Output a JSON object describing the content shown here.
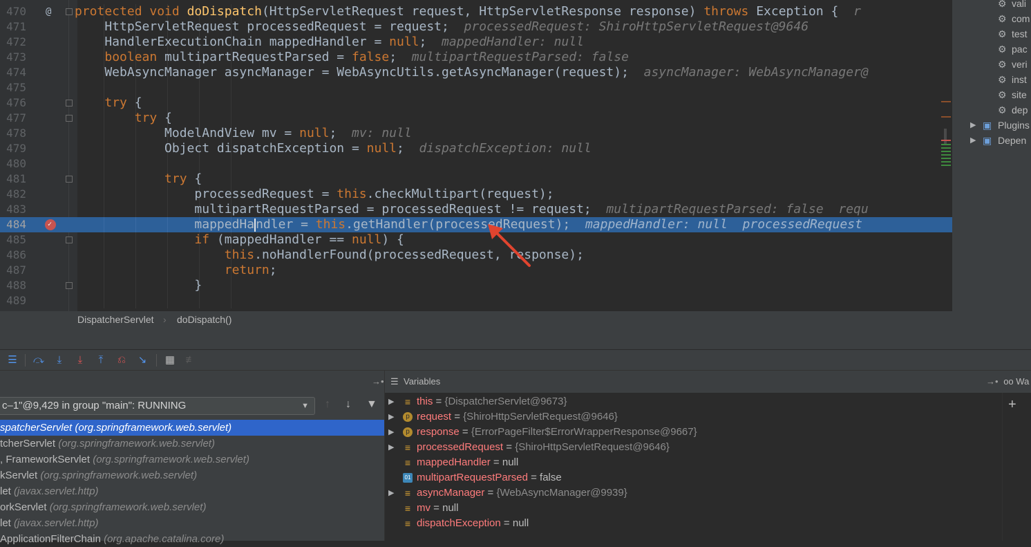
{
  "editor": {
    "lines": [
      {
        "num": "470",
        "tokens": [
          {
            "t": "protected void ",
            "c": "kw"
          },
          {
            "t": "doDispatch",
            "c": "me"
          },
          {
            "t": "(HttpServletRequest request, HttpServletResponse response) "
          },
          {
            "t": "throws ",
            "c": "kw"
          },
          {
            "t": "Exception {  "
          },
          {
            "t": "r",
            "c": "hint"
          }
        ]
      },
      {
        "num": "471",
        "tokens": [
          {
            "t": "    HttpServletRequest processedRequest = request;"
          },
          {
            "t": "  processedRequest: ShiroHttpServletRequest@9646",
            "c": "hint"
          }
        ]
      },
      {
        "num": "472",
        "tokens": [
          {
            "t": "    HandlerExecutionChain mappedHandler = "
          },
          {
            "t": "null",
            "c": "kw"
          },
          {
            "t": ";"
          },
          {
            "t": "  mappedHandler: null",
            "c": "hint"
          }
        ]
      },
      {
        "num": "473",
        "tokens": [
          {
            "t": "    "
          },
          {
            "t": "boolean ",
            "c": "kw"
          },
          {
            "t": "multipartRequestParsed = "
          },
          {
            "t": "false",
            "c": "kw"
          },
          {
            "t": ";"
          },
          {
            "t": "  multipartRequestParsed: false",
            "c": "hint"
          }
        ]
      },
      {
        "num": "474",
        "tokens": [
          {
            "t": "    WebAsyncManager asyncManager = WebAsyncUtils.getAsyncManager(request);"
          },
          {
            "t": "  asyncManager: WebAsyncManager@",
            "c": "hint"
          }
        ]
      },
      {
        "num": "475",
        "tokens": []
      },
      {
        "num": "476",
        "tokens": [
          {
            "t": "    "
          },
          {
            "t": "try ",
            "c": "kw"
          },
          {
            "t": "{"
          }
        ]
      },
      {
        "num": "477",
        "tokens": [
          {
            "t": "        "
          },
          {
            "t": "try ",
            "c": "kw"
          },
          {
            "t": "{"
          }
        ]
      },
      {
        "num": "478",
        "tokens": [
          {
            "t": "            ModelAndView mv = "
          },
          {
            "t": "null",
            "c": "kw"
          },
          {
            "t": ";"
          },
          {
            "t": "  mv: null",
            "c": "hint"
          }
        ]
      },
      {
        "num": "479",
        "tokens": [
          {
            "t": "            Object dispatchException = "
          },
          {
            "t": "null",
            "c": "kw"
          },
          {
            "t": ";"
          },
          {
            "t": "  dispatchException: null",
            "c": "hint"
          }
        ]
      },
      {
        "num": "480",
        "tokens": []
      },
      {
        "num": "481",
        "tokens": [
          {
            "t": "            "
          },
          {
            "t": "try ",
            "c": "kw"
          },
          {
            "t": "{"
          }
        ]
      },
      {
        "num": "482",
        "tokens": [
          {
            "t": "                processedRequest = "
          },
          {
            "t": "this",
            "c": "kw"
          },
          {
            "t": ".checkMultipart(request);"
          }
        ]
      },
      {
        "num": "483",
        "tokens": [
          {
            "t": "                multipartRequestParsed = processedRequest != request;"
          },
          {
            "t": "  multipartRequestParsed: false  requ",
            "c": "hint"
          }
        ]
      },
      {
        "num": "484",
        "tokens": [
          {
            "t": "                mappedHa"
          },
          {
            "t": "",
            "c": "caret"
          },
          {
            "t": "ndler = "
          },
          {
            "t": "this",
            "c": "kw"
          },
          {
            "t": ".getHandler(processedRequest);"
          },
          {
            "t": "  mappedHandler: null  processedRequest",
            "c": "hint"
          }
        ]
      },
      {
        "num": "485",
        "tokens": [
          {
            "t": "                "
          },
          {
            "t": "if ",
            "c": "kw"
          },
          {
            "t": "(mappedHandler == "
          },
          {
            "t": "null",
            "c": "kw"
          },
          {
            "t": ") {"
          }
        ]
      },
      {
        "num": "486",
        "tokens": [
          {
            "t": "                    "
          },
          {
            "t": "this",
            "c": "kw"
          },
          {
            "t": ".noHandlerFound(processedRequest, response);"
          }
        ]
      },
      {
        "num": "487",
        "tokens": [
          {
            "t": "                    "
          },
          {
            "t": "return",
            "c": "kw"
          },
          {
            "t": ";"
          }
        ]
      },
      {
        "num": "488",
        "tokens": [
          {
            "t": "                }"
          }
        ]
      },
      {
        "num": "489",
        "tokens": []
      }
    ]
  },
  "breadcrumb": {
    "class_name": "DispatcherServlet",
    "method_name": "doDispatch()"
  },
  "project_tree": {
    "items": [
      {
        "label": "vali"
      },
      {
        "label": "com"
      },
      {
        "label": "test"
      },
      {
        "label": "pac"
      },
      {
        "label": "veri"
      },
      {
        "label": "inst"
      },
      {
        "label": "site"
      },
      {
        "label": "dep"
      },
      {
        "label": "Plugins"
      },
      {
        "label": "Depen"
      }
    ]
  },
  "frames": {
    "thread_label": "c–1\"@9,429 in group \"main\": RUNNING",
    "items": [
      {
        "name": "spatcherServlet",
        "pkg": "(org.springframework.web.servlet)",
        "selected": true
      },
      {
        "name": "tcherServlet",
        "pkg": "(org.springframework.web.servlet)"
      },
      {
        "name": ", FrameworkServlet",
        "pkg": "(org.springframework.web.servlet)"
      },
      {
        "name": "kServlet",
        "pkg": "(org.springframework.web.servlet)"
      },
      {
        "name": "let",
        "pkg": "(javax.servlet.http)"
      },
      {
        "name": "orkServlet",
        "pkg": "(org.springframework.web.servlet)"
      },
      {
        "name": "let",
        "pkg": "(javax.servlet.http)"
      },
      {
        "name": "ApplicationFilterChain",
        "pkg": "(org.apache.catalina.core)"
      }
    ]
  },
  "variables": {
    "title": "Variables",
    "items": [
      {
        "name": "this",
        "value": "{DispatcherServlet@9673}",
        "ref": true,
        "icon": "field-icon",
        "expandable": true
      },
      {
        "name": "request",
        "value": "{ShiroHttpServletRequest@9646}",
        "ref": true,
        "icon": "param-icon",
        "expandable": true
      },
      {
        "name": "response",
        "value": "{ErrorPageFilter$ErrorWrapperResponse@9667}",
        "ref": true,
        "icon": "param-icon",
        "expandable": true
      },
      {
        "name": "processedRequest",
        "value": "{ShiroHttpServletRequest@9646}",
        "ref": true,
        "icon": "field-icon",
        "expandable": true
      },
      {
        "name": "mappedHandler",
        "value": "null",
        "ref": false,
        "icon": "field-icon",
        "expandable": false
      },
      {
        "name": "multipartRequestParsed",
        "value": "false",
        "ref": false,
        "icon": "primitive-icon",
        "expandable": false
      },
      {
        "name": "asyncManager",
        "value": "{WebAsyncManager@9939}",
        "ref": true,
        "icon": "field-icon",
        "expandable": true
      },
      {
        "name": "mv",
        "value": "null",
        "ref": false,
        "icon": "field-icon",
        "expandable": false
      },
      {
        "name": "dispatchException",
        "value": "null",
        "ref": false,
        "icon": "field-icon",
        "expandable": false
      }
    ]
  },
  "watches": {
    "title": "Wa"
  },
  "colors": {
    "keyword": "#cc7832",
    "method": "#ffc66d",
    "selection": "#2d6099",
    "frame_selection": "#2f65ca",
    "var_name": "#ff7c7c",
    "breakpoint": "#c75450",
    "arrow": "#e0442f"
  }
}
